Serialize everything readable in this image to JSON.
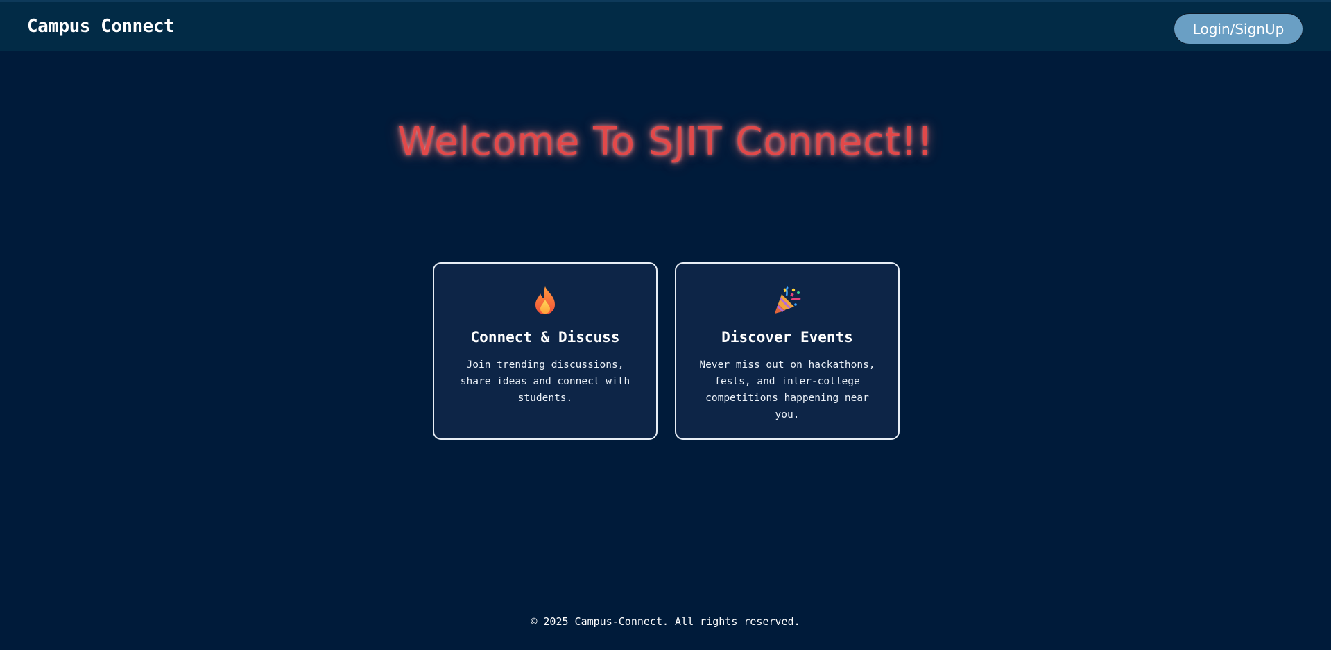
{
  "header": {
    "brand": "Campus Connect",
    "login_label": "Login/SignUp"
  },
  "hero": {
    "title": "Welcome To SJIT Connect!!"
  },
  "features": [
    {
      "icon": "fire-icon",
      "title": "Connect & Discuss",
      "description": "Join trending discussions, share ideas and connect with students."
    },
    {
      "icon": "party-popper-icon",
      "title": "Discover Events",
      "description": "Never miss out on hackathons, fests, and inter-college competitions happening near you."
    }
  ],
  "footer": {
    "text": "© 2025 Campus-Connect. All rights reserved."
  },
  "colors": {
    "background": "#001b3a",
    "header": "#022b46",
    "accent_title": "#e2494a",
    "button": "#6a9fc4",
    "card": "#0d2547"
  }
}
